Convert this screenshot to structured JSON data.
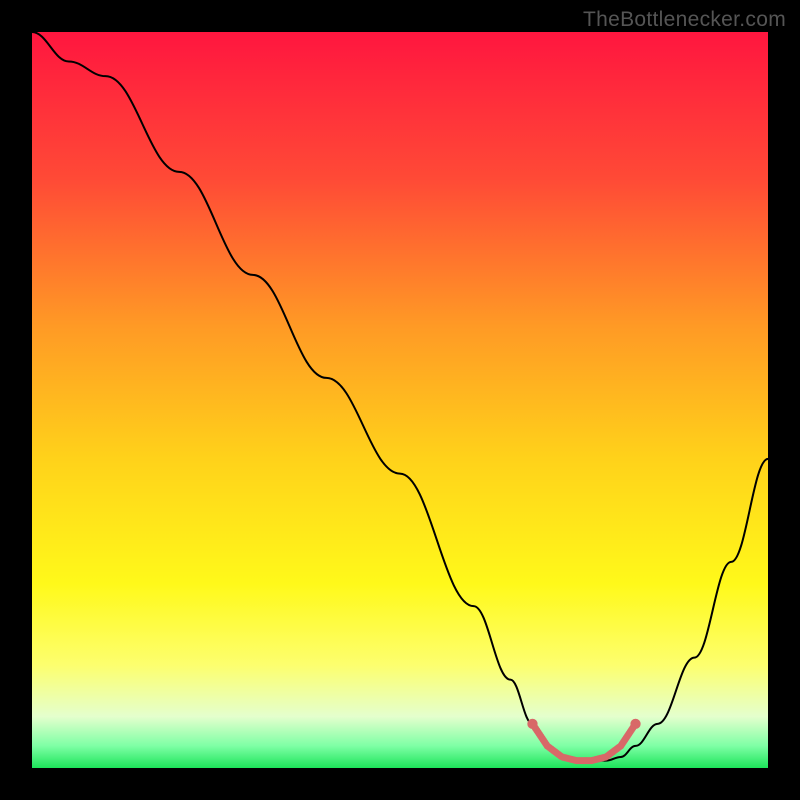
{
  "watermark": "TheBottlenecker.com",
  "chart_data": {
    "type": "line",
    "title": "",
    "xlabel": "",
    "ylabel": "",
    "xlim": [
      0,
      100
    ],
    "ylim": [
      0,
      100
    ],
    "series": [
      {
        "name": "bottleneck-curve",
        "x": [
          0,
          5,
          10,
          20,
          30,
          40,
          50,
          60,
          65,
          68,
          70,
          72,
          74,
          76,
          78,
          80,
          82,
          85,
          90,
          95,
          100
        ],
        "y": [
          100,
          96,
          94,
          81,
          67,
          53,
          40,
          22,
          12,
          6,
          3,
          1.5,
          1,
          1,
          1,
          1.5,
          3,
          6,
          15,
          28,
          42
        ]
      }
    ],
    "highlight": {
      "name": "optimal-range",
      "x": [
        68,
        70,
        72,
        74,
        76,
        78,
        80,
        82
      ],
      "y": [
        6,
        3,
        1.5,
        1,
        1,
        1.5,
        3,
        6
      ],
      "color": "#d86868"
    },
    "background_gradient": {
      "type": "vertical",
      "stops": [
        {
          "pos": 0.0,
          "color": "#ff163f"
        },
        {
          "pos": 0.2,
          "color": "#ff4a36"
        },
        {
          "pos": 0.4,
          "color": "#ff9a25"
        },
        {
          "pos": 0.58,
          "color": "#ffd21a"
        },
        {
          "pos": 0.75,
          "color": "#fff91a"
        },
        {
          "pos": 0.86,
          "color": "#fdff6e"
        },
        {
          "pos": 0.93,
          "color": "#e4ffcd"
        },
        {
          "pos": 0.97,
          "color": "#7effa5"
        },
        {
          "pos": 1.0,
          "color": "#1de45a"
        }
      ]
    }
  }
}
